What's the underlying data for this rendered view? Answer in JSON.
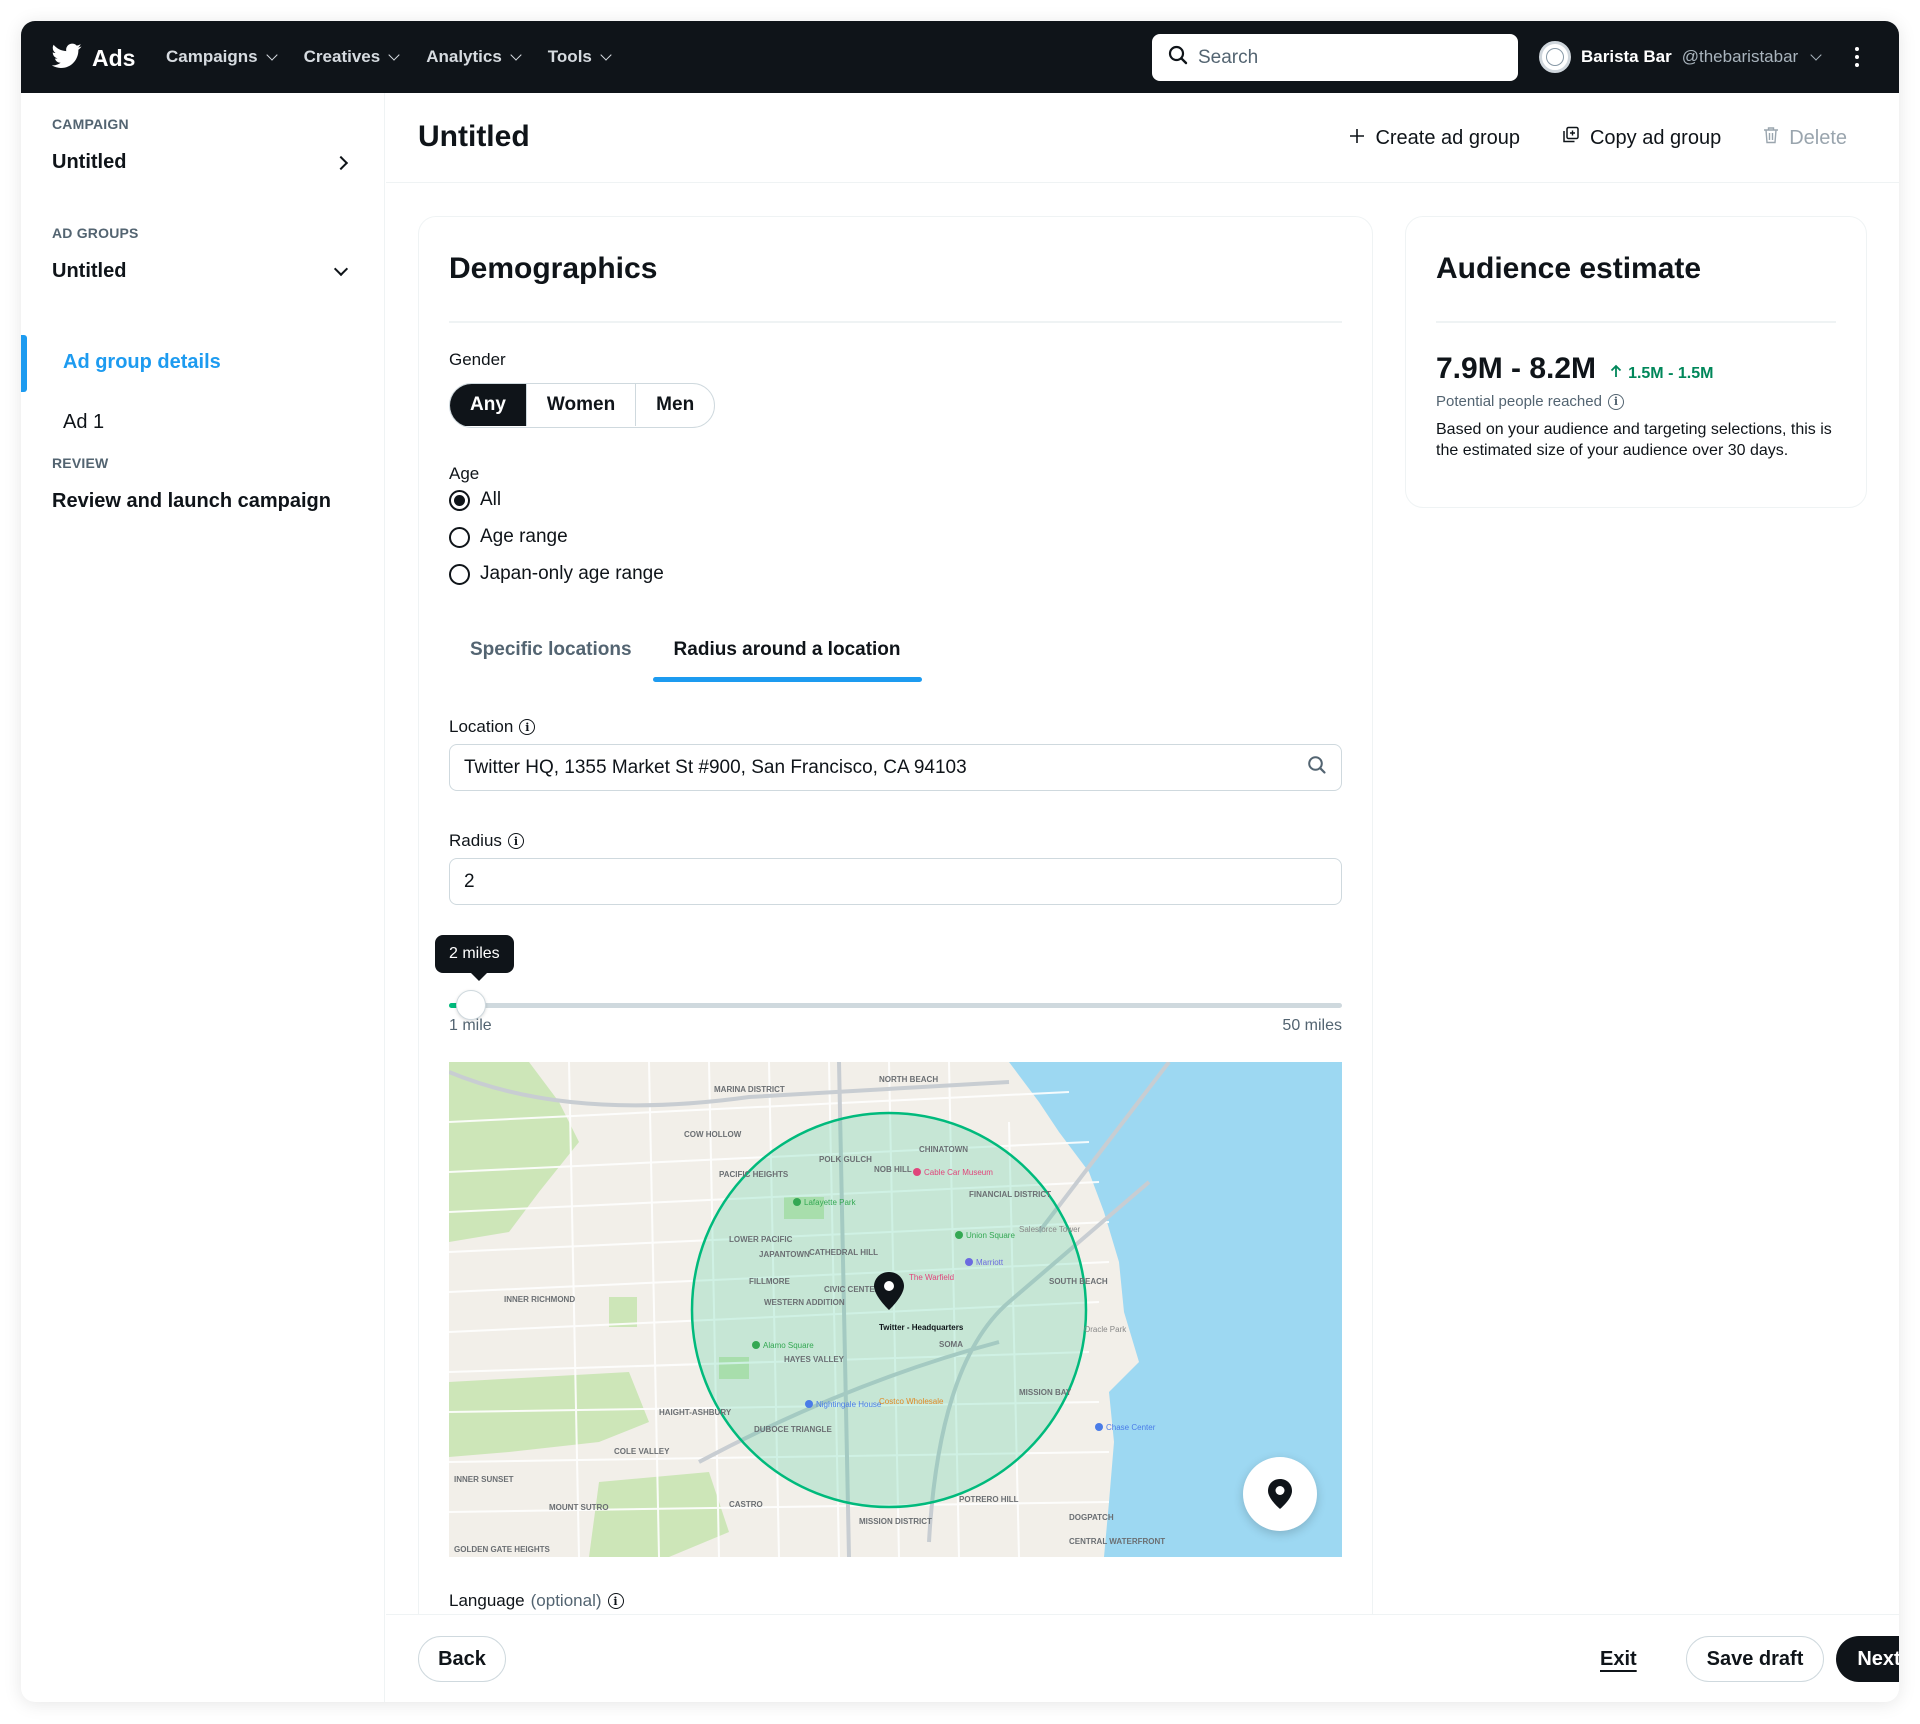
{
  "topnav": {
    "brand": "Ads",
    "menu": [
      {
        "label": "Campaigns"
      },
      {
        "label": "Creatives"
      },
      {
        "label": "Analytics"
      },
      {
        "label": "Tools"
      }
    ],
    "search_placeholder": "Search",
    "account_name": "Barista Bar",
    "account_handle": "@thebaristabar"
  },
  "sidebar": {
    "campaign_section": "CAMPAIGN",
    "campaign_name": "Untitled",
    "adgroups_section": "AD GROUPS",
    "adgroup_name": "Untitled",
    "adgroup_items": [
      {
        "label": "Ad group details",
        "active": true
      },
      {
        "label": "Ad 1",
        "active": false
      }
    ],
    "review_section": "REVIEW",
    "review_item": "Review and launch campaign"
  },
  "header": {
    "title": "Untitled",
    "actions": {
      "create": "Create ad group",
      "copy": "Copy ad group",
      "delete": "Delete"
    }
  },
  "demographics": {
    "title": "Demographics",
    "gender_label": "Gender",
    "gender_options": [
      "Any",
      "Women",
      "Men"
    ],
    "gender_selected": "Any",
    "age_label": "Age",
    "age_options": [
      "All",
      "Age range",
      "Japan-only age range"
    ],
    "age_selected": "All",
    "location_tabs": [
      "Specific locations",
      "Radius around a location"
    ],
    "location_tab_active": "Radius around a location",
    "location_label": "Location",
    "location_value": "Twitter HQ, 1355 Market St #900, San Francisco, CA 94103",
    "radius_label": "Radius",
    "radius_value": "2",
    "slider": {
      "tooltip": "2 miles",
      "min_label": "1 mile",
      "max_label": "50 miles",
      "min": 1,
      "max": 50,
      "value": 2
    },
    "map": {
      "center_label": "Twitter - Headquarters",
      "neighborhoods": [
        "MARINA DISTRICT",
        "NORTH BEACH",
        "COW HOLLOW",
        "CHINATOWN",
        "POLK GULCH",
        "NOB HILL",
        "PACIFIC HEIGHTS",
        "FINANCIAL DISTRICT",
        "LOWER PACIFIC HEIGHTS",
        "JAPANTOWN",
        "CATHEDRAL HILL",
        "SOUTH BEACH",
        "FILLMORE DISTRICT",
        "CIVIC CENTER",
        "WESTERN ADDITION",
        "INNER RICHMOND",
        "SOMA",
        "HAYES VALLEY",
        "MISSION BAY",
        "HAIGHT-ASHBURY",
        "DUBOCE TRIANGLE",
        "COLE VALLEY",
        "INNER SUNSET",
        "CASTRO",
        "MISSION DISTRICT",
        "POTRERO HILL",
        "DOGPATCH",
        "CENTRAL WATERFRONT",
        "GOLDEN GATE HEIGHTS",
        "MOUNT SUTRO FOREST"
      ],
      "pois": [
        "Union Square",
        "Lafayette Park",
        "Alamo Square",
        "Cable Car Museum",
        "Salesforce Tower",
        "Oracle Park",
        "Chase Center",
        "Costco Wholesale",
        "Nightingale House",
        "Marriott",
        "The Warfield"
      ]
    },
    "language_label": "Language",
    "language_optional": "(optional)"
  },
  "audience": {
    "title": "Audience estimate",
    "range": "7.9M - 8.2M",
    "delta": "1.5M - 1.5M",
    "subtitle": "Potential people reached",
    "description": "Based on your audience and targeting selections, this is the estimated size of your audience over 30 days."
  },
  "footer": {
    "back": "Back",
    "exit": "Exit",
    "save_draft": "Save draft",
    "next": "Next"
  },
  "colors": {
    "nav_bg": "#0f1419",
    "accent": "#1d9bf0",
    "positive": "#00875a",
    "radius_circle": "#00ba7c",
    "water": "#9dd8f2"
  }
}
